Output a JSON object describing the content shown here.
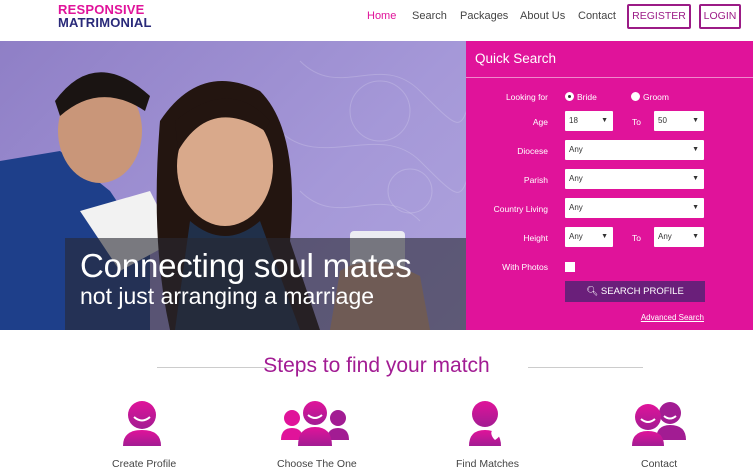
{
  "brand": {
    "line1": "RESPONSIVE",
    "line2": "MATRIMONIAL"
  },
  "nav": {
    "home": "Home",
    "search": "Search",
    "packages": "Packages",
    "about": "About Us",
    "contact": "Contact",
    "register": "REGISTER",
    "login": "LOGIN"
  },
  "hero": {
    "caption_line1": "Connecting soul mates",
    "caption_line2": "not just arranging a marriage"
  },
  "quick_search": {
    "title": "Quick Search",
    "looking_for_label": "Looking for",
    "option_bride": "Bride",
    "option_groom": "Groom",
    "selected": "Bride",
    "age_label": "Age",
    "age_from": "18",
    "age_to_label": "To",
    "age_to": "50",
    "diocese_label": "Diocese",
    "diocese_value": "Any",
    "parish_label": "Parish",
    "parish_value": "Any",
    "country_label": "Country Living",
    "country_value": "Any",
    "height_label": "Height",
    "height_from": "Any",
    "height_to_label": "To",
    "height_to": "Any",
    "photos_label": "With Photos",
    "search_button": "SEARCH PROFILE",
    "advanced_link": "Advanced Search"
  },
  "steps": {
    "title": "Steps to find your match",
    "items": [
      {
        "label": "Create Profile",
        "icon": "person-icon"
      },
      {
        "label": "Choose The One",
        "icon": "group-icon"
      },
      {
        "label": "Find Matches",
        "icon": "person-heart-icon"
      },
      {
        "label": "Contact",
        "icon": "couple-icon"
      }
    ]
  },
  "colors": {
    "accent": "#e0139a",
    "brand_dark": "#2a2a7a",
    "button_purple": "#6a1f7a",
    "title_purple": "#a21c93"
  }
}
